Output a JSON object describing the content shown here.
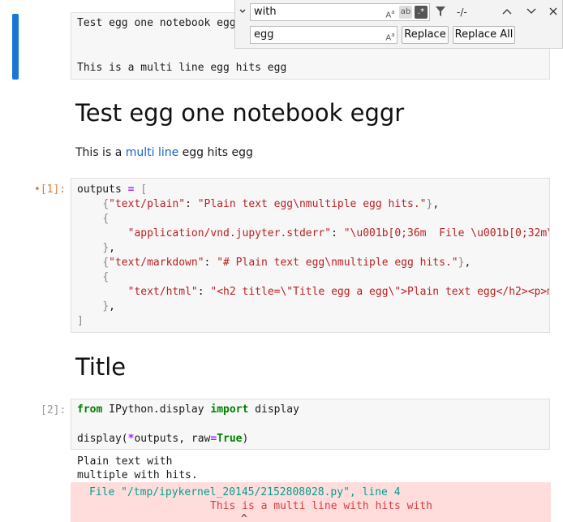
{
  "find": {
    "search_value": "with",
    "replace_value": "egg",
    "match_count": "-/-",
    "replace_label": "Replace",
    "replace_all_label": "Replace All"
  },
  "cell0": {
    "lines": [
      "Test egg one notebook egg",
      "",
      "This is a multi line egg hits egg"
    ]
  },
  "md1": {
    "heading": "Test egg one notebook eggr",
    "para_before": "This is a ",
    "para_link": "multi line",
    "para_after": " egg hits egg"
  },
  "cell1": {
    "prompt": "•[1]:",
    "lines": {
      "l1_var": "outputs",
      "l1_eq": "=",
      "l1_br": "[",
      "l2_key": "\"text/plain\"",
      "l2_val": "\"Plain text egg\\nmultiple egg hits.\"",
      "l4_key": "\"application/vnd.jupyter.stderr\"",
      "l4_val": "\"\\u001b[0;36m  File \\u001b[0;32m\\",
      "l6_key": "\"text/markdown\"",
      "l6_val": "\"# Plain text egg\\nmultiple egg hits.\"",
      "l8_key": "\"text/html\"",
      "l8_val": "\"<h2 title=\\\"Title egg a egg\\\">Plain text egg</h2><p>m",
      "l10": "]"
    }
  },
  "md2": {
    "heading": "Title"
  },
  "cell2": {
    "prompt": "[2]:",
    "kw_from": "from",
    "mod": " IPython.display ",
    "kw_import": "import",
    "name": " display",
    "call": "display(",
    "star": "*",
    "args": "outputs, raw",
    "eq": "=",
    "true_kw": "True",
    "close": ")"
  },
  "output2": {
    "text_lines": [
      "Plain text with",
      "multiple with hits."
    ],
    "err_file_label": "File",
    "err_path": "\"/tmp/ipykernel_20145/2152808028.py\"",
    "err_line_label": ", line",
    "err_line_no": "4",
    "err_source": "This is a multi line with hits with",
    "err_caret": "^"
  }
}
